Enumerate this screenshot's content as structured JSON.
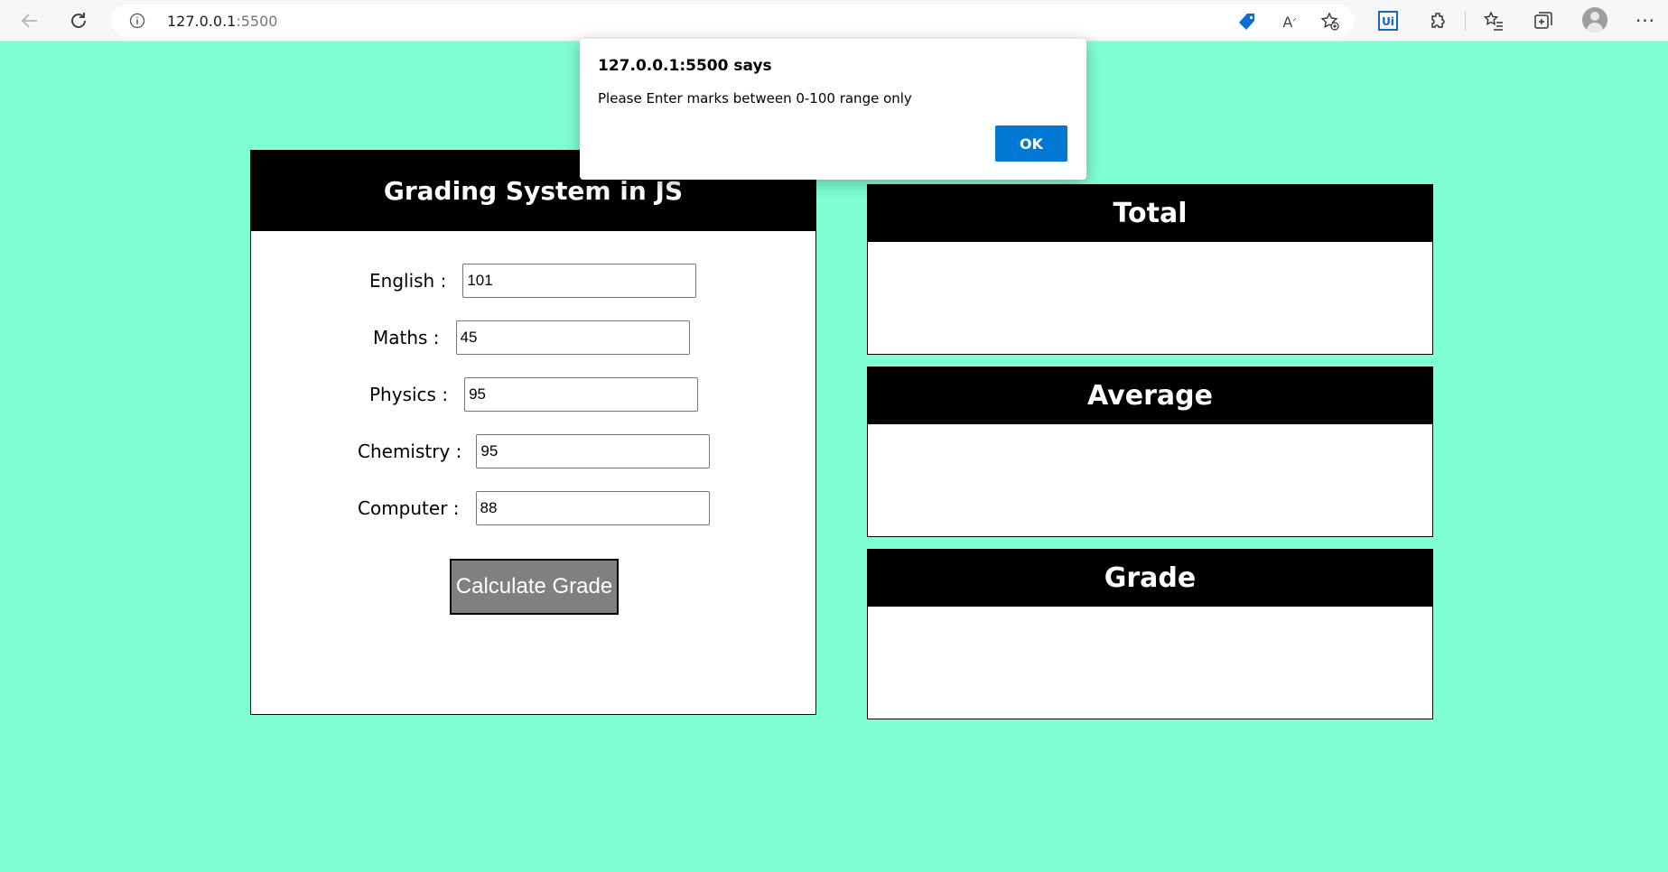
{
  "browser": {
    "url_host": "127.0.0.1",
    "url_port": ":5500"
  },
  "app": {
    "title": "Grading System in JS",
    "fields": [
      {
        "label": "English :",
        "value": "101"
      },
      {
        "label": "Maths :",
        "value": "45"
      },
      {
        "label": "Physics :",
        "value": "95"
      },
      {
        "label": "Chemistry :",
        "value": "95"
      },
      {
        "label": "Computer :",
        "value": "88"
      }
    ],
    "calculate_label": "Calculate Grade",
    "results": {
      "total_label": "Total",
      "total_value": "",
      "average_label": "Average",
      "average_value": "",
      "grade_label": "Grade",
      "grade_value": ""
    }
  },
  "dialog": {
    "title": "127.0.0.1:5500 says",
    "message": "Please Enter marks between 0-100 range only",
    "ok_label": "OK"
  },
  "colors": {
    "page_background": "#7fffd4",
    "panel_header": "#000000",
    "button_background": "#808080",
    "dialog_ok": "#0078d4"
  }
}
